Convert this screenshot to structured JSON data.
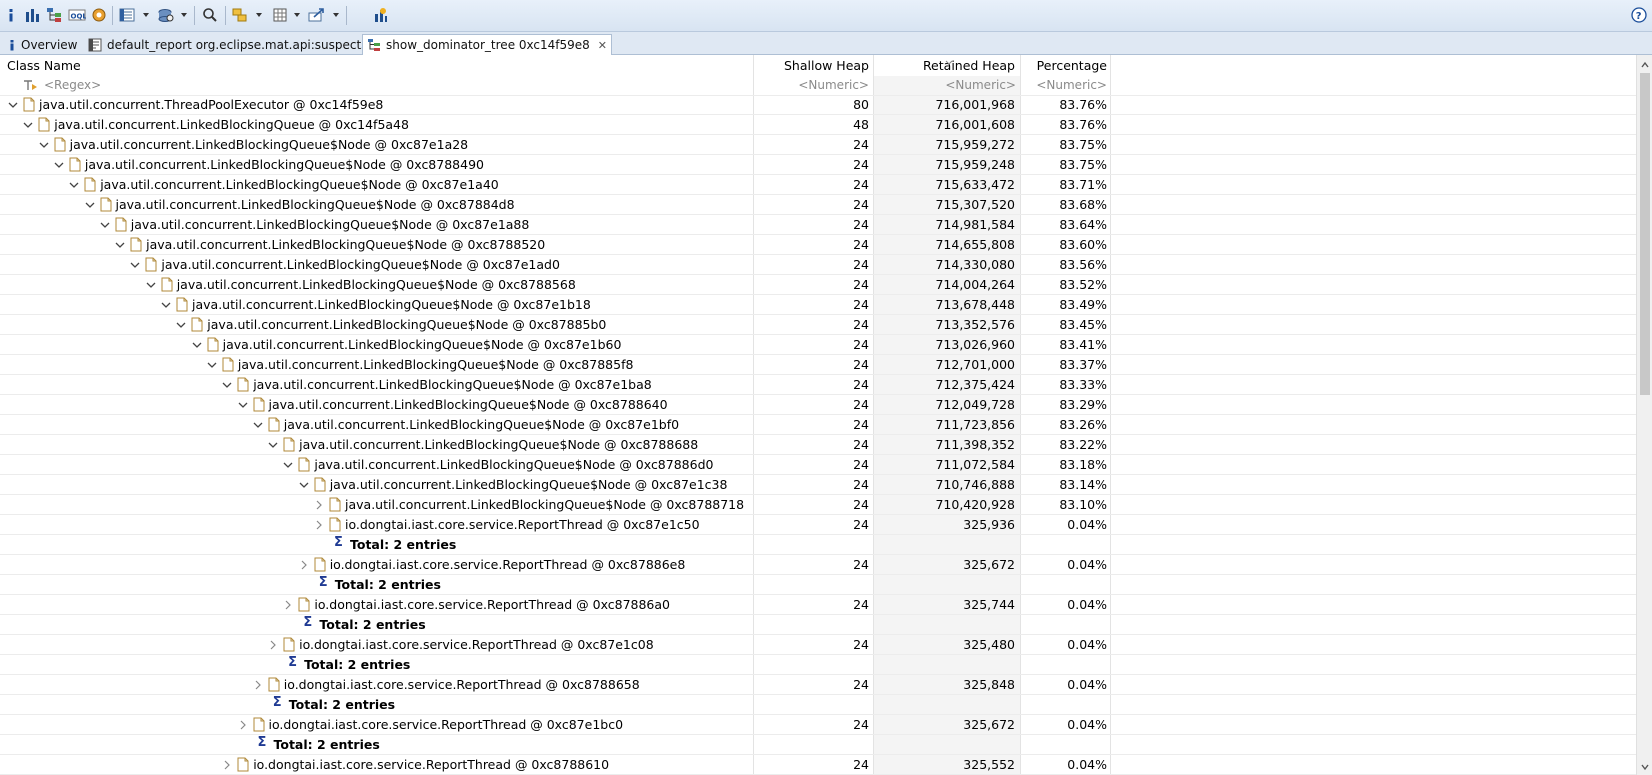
{
  "toolbar": {
    "icons": [
      "info-icon",
      "histogram-icon",
      "dominator-tree-icon",
      "oql-icon",
      "heap-dump-overview-icon",
      "query-browser-icon",
      "find-object-icon",
      "search-icon",
      "group-by-icon",
      "calculate-icon",
      "export-icon",
      "leak-suspects-icon",
      "help-icon"
    ]
  },
  "tabs": [
    {
      "label": "Overview",
      "icon": "info-icon"
    },
    {
      "label": "default_report  org.eclipse.mat.api:suspects",
      "icon": "report-icon"
    },
    {
      "label": "show_dominator_tree  0xc14f59e8",
      "icon": "dominator-tree-icon",
      "active": true
    }
  ],
  "columns": {
    "class_name": "Class Name",
    "shallow_heap": "Shallow Heap",
    "retained_heap": "Retained Heap",
    "percentage": "Percentage"
  },
  "filters": {
    "class_name": "<Regex>",
    "shallow_heap": "<Numeric>",
    "retained_heap": "<Numeric>",
    "percentage": "<Numeric>"
  },
  "rows": [
    {
      "name": "java.util.concurrent.ThreadPoolExecutor @ 0xc14f59e8",
      "shallow": "80",
      "retained": "716,001,968",
      "pct": "83.76%",
      "level": 0,
      "expanded": true
    },
    {
      "name": "java.util.concurrent.LinkedBlockingQueue @ 0xc14f5a48",
      "shallow": "48",
      "retained": "716,001,608",
      "pct": "83.76%",
      "level": 1,
      "expanded": true
    },
    {
      "name": "java.util.concurrent.LinkedBlockingQueue$Node @ 0xc87e1a28",
      "shallow": "24",
      "retained": "715,959,272",
      "pct": "83.75%",
      "level": 2,
      "expanded": true
    },
    {
      "name": "java.util.concurrent.LinkedBlockingQueue$Node @ 0xc8788490",
      "shallow": "24",
      "retained": "715,959,248",
      "pct": "83.75%",
      "level": 3,
      "expanded": true
    },
    {
      "name": "java.util.concurrent.LinkedBlockingQueue$Node @ 0xc87e1a40",
      "shallow": "24",
      "retained": "715,633,472",
      "pct": "83.71%",
      "level": 4,
      "expanded": true
    },
    {
      "name": "java.util.concurrent.LinkedBlockingQueue$Node @ 0xc87884d8",
      "shallow": "24",
      "retained": "715,307,520",
      "pct": "83.68%",
      "level": 5,
      "expanded": true
    },
    {
      "name": "java.util.concurrent.LinkedBlockingQueue$Node @ 0xc87e1a88",
      "shallow": "24",
      "retained": "714,981,584",
      "pct": "83.64%",
      "level": 6,
      "expanded": true
    },
    {
      "name": "java.util.concurrent.LinkedBlockingQueue$Node @ 0xc8788520",
      "shallow": "24",
      "retained": "714,655,808",
      "pct": "83.60%",
      "level": 7,
      "expanded": true
    },
    {
      "name": "java.util.concurrent.LinkedBlockingQueue$Node @ 0xc87e1ad0",
      "shallow": "24",
      "retained": "714,330,080",
      "pct": "83.56%",
      "level": 8,
      "expanded": true
    },
    {
      "name": "java.util.concurrent.LinkedBlockingQueue$Node @ 0xc8788568",
      "shallow": "24",
      "retained": "714,004,264",
      "pct": "83.52%",
      "level": 9,
      "expanded": true
    },
    {
      "name": "java.util.concurrent.LinkedBlockingQueue$Node @ 0xc87e1b18",
      "shallow": "24",
      "retained": "713,678,448",
      "pct": "83.49%",
      "level": 10,
      "expanded": true
    },
    {
      "name": "java.util.concurrent.LinkedBlockingQueue$Node @ 0xc87885b0",
      "shallow": "24",
      "retained": "713,352,576",
      "pct": "83.45%",
      "level": 11,
      "expanded": true
    },
    {
      "name": "java.util.concurrent.LinkedBlockingQueue$Node @ 0xc87e1b60",
      "shallow": "24",
      "retained": "713,026,960",
      "pct": "83.41%",
      "level": 12,
      "expanded": true
    },
    {
      "name": "java.util.concurrent.LinkedBlockingQueue$Node @ 0xc87885f8",
      "shallow": "24",
      "retained": "712,701,000",
      "pct": "83.37%",
      "level": 13,
      "expanded": true
    },
    {
      "name": "java.util.concurrent.LinkedBlockingQueue$Node @ 0xc87e1ba8",
      "shallow": "24",
      "retained": "712,375,424",
      "pct": "83.33%",
      "level": 14,
      "expanded": true
    },
    {
      "name": "java.util.concurrent.LinkedBlockingQueue$Node @ 0xc8788640",
      "shallow": "24",
      "retained": "712,049,728",
      "pct": "83.29%",
      "level": 15,
      "expanded": true
    },
    {
      "name": "java.util.concurrent.LinkedBlockingQueue$Node @ 0xc87e1bf0",
      "shallow": "24",
      "retained": "711,723,856",
      "pct": "83.26%",
      "level": 16,
      "expanded": true
    },
    {
      "name": "java.util.concurrent.LinkedBlockingQueue$Node @ 0xc8788688",
      "shallow": "24",
      "retained": "711,398,352",
      "pct": "83.22%",
      "level": 17,
      "expanded": true
    },
    {
      "name": "java.util.concurrent.LinkedBlockingQueue$Node @ 0xc87886d0",
      "shallow": "24",
      "retained": "711,072,584",
      "pct": "83.18%",
      "level": 18,
      "expanded": true
    },
    {
      "name": "java.util.concurrent.LinkedBlockingQueue$Node @ 0xc87e1c38",
      "shallow": "24",
      "retained": "710,746,888",
      "pct": "83.14%",
      "level": 19,
      "expanded": true
    },
    {
      "name": "java.util.concurrent.LinkedBlockingQueue$Node @ 0xc8788718",
      "shallow": "24",
      "retained": "710,420,928",
      "pct": "83.10%",
      "level": 20,
      "expanded": false
    },
    {
      "name": "io.dongtai.iast.core.service.ReportThread @ 0xc87e1c50",
      "shallow": "24",
      "retained": "325,936",
      "pct": "0.04%",
      "level": 20,
      "expanded": false
    },
    {
      "name": "Total: 2 entries",
      "level": 20,
      "total": true
    },
    {
      "name": "io.dongtai.iast.core.service.ReportThread @ 0xc87886e8",
      "shallow": "24",
      "retained": "325,672",
      "pct": "0.04%",
      "level": 19,
      "expanded": false
    },
    {
      "name": "Total: 2 entries",
      "level": 19,
      "total": true
    },
    {
      "name": "io.dongtai.iast.core.service.ReportThread @ 0xc87886a0",
      "shallow": "24",
      "retained": "325,744",
      "pct": "0.04%",
      "level": 18,
      "expanded": false
    },
    {
      "name": "Total: 2 entries",
      "level": 18,
      "total": true
    },
    {
      "name": "io.dongtai.iast.core.service.ReportThread @ 0xc87e1c08",
      "shallow": "24",
      "retained": "325,480",
      "pct": "0.04%",
      "level": 17,
      "expanded": false
    },
    {
      "name": "Total: 2 entries",
      "level": 17,
      "total": true
    },
    {
      "name": "io.dongtai.iast.core.service.ReportThread @ 0xc8788658",
      "shallow": "24",
      "retained": "325,848",
      "pct": "0.04%",
      "level": 16,
      "expanded": false
    },
    {
      "name": "Total: 2 entries",
      "level": 16,
      "total": true
    },
    {
      "name": "io.dongtai.iast.core.service.ReportThread @ 0xc87e1bc0",
      "shallow": "24",
      "retained": "325,672",
      "pct": "0.04%",
      "level": 15,
      "expanded": false
    },
    {
      "name": "Total: 2 entries",
      "level": 15,
      "total": true
    },
    {
      "name": "io.dongtai.iast.core.service.ReportThread @ 0xc8788610",
      "shallow": "24",
      "retained": "325,552",
      "pct": "0.04%",
      "level": 14,
      "expanded": false
    }
  ],
  "colors": {
    "toolbar_bg": "#dfe8f3",
    "retained_column_bg": "#f4f4f4",
    "sigma": "#1f3a93"
  }
}
